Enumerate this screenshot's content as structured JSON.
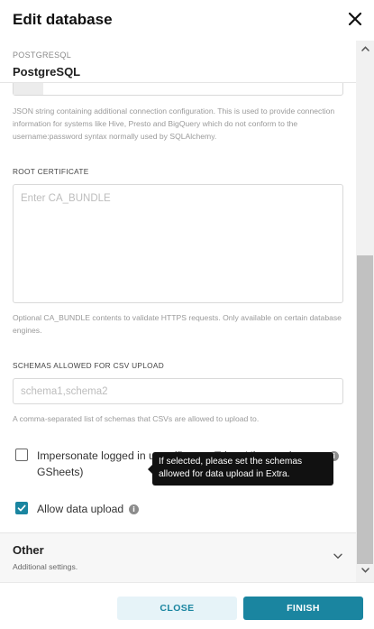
{
  "modal": {
    "title": "Edit database"
  },
  "database": {
    "type_label": "POSTGRESQL",
    "name": "PostgreSQL"
  },
  "extra": {
    "help": "JSON string containing additional connection configuration. This is used to provide connection information for systems like Hive, Presto and BigQuery which do not conform to the username:password syntax normally used by SQLAlchemy."
  },
  "root_certificate": {
    "label": "ROOT CERTIFICATE",
    "placeholder": "Enter CA_BUNDLE",
    "help": "Optional CA_BUNDLE contents to validate HTTPS requests. Only available on certain database engines."
  },
  "csv_schemas": {
    "label": "SCHEMAS ALLOWED FOR CSV UPLOAD",
    "placeholder": "schema1,schema2",
    "help": "A comma-separated list of schemas that CSVs are allowed to upload to."
  },
  "impersonate": {
    "label": "Impersonate logged in user (Presto, Trino, Hive, and GSheets)",
    "checked": false
  },
  "allow_upload": {
    "label": "Allow data upload",
    "checked": true,
    "tooltip": "If selected, please set the schemas allowed for data upload in Extra."
  },
  "other_section": {
    "title": "Other",
    "subtitle": "Additional settings."
  },
  "footer": {
    "close_label": "CLOSE",
    "finish_label": "FINISH"
  },
  "colors": {
    "accent": "#1a85a0",
    "accent_light": "#e6f3f8"
  }
}
